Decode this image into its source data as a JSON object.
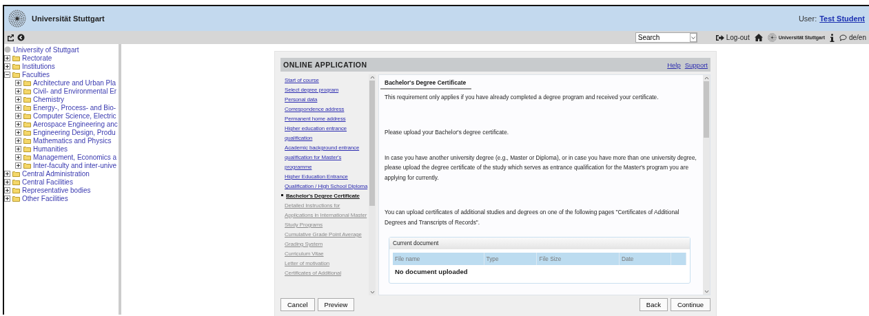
{
  "header": {
    "title": "Universität Stuttgart",
    "user_label": "User:",
    "user_name": "Test Student"
  },
  "toolbar": {
    "search": {
      "value": "Search"
    },
    "logout": "Log-out",
    "logo_text": "Universität Stuttgart",
    "language": "de/en"
  },
  "tree": {
    "root": "University of Stuttgart",
    "items": [
      {
        "label": "Rectorate",
        "expanded": false
      },
      {
        "label": "Institutions",
        "expanded": false
      },
      {
        "label": "Faculties",
        "expanded": true,
        "children": [
          {
            "label": "Architecture and Urban Pla",
            "expanded": false
          },
          {
            "label": "Civil- and Environmental Er",
            "expanded": false
          },
          {
            "label": "Chemistry",
            "expanded": false
          },
          {
            "label": "Energy-, Process- and Bio-",
            "expanded": false
          },
          {
            "label": "Computer Science, Electric",
            "expanded": false
          },
          {
            "label": "Aerospace Engineering anc",
            "expanded": false
          },
          {
            "label": "Engineering Design, Produ",
            "expanded": false
          },
          {
            "label": "Mathematics and Physics",
            "expanded": false
          },
          {
            "label": "Humanities",
            "expanded": false
          },
          {
            "label": "Management, Economics a",
            "expanded": false
          },
          {
            "label": "Inter-faculty and inter-unive",
            "expanded": false
          }
        ]
      },
      {
        "label": "Central Administration",
        "expanded": false
      },
      {
        "label": "Central Facilities",
        "expanded": false
      },
      {
        "label": "Representative bodies",
        "expanded": false
      },
      {
        "label": "Other Facilities",
        "expanded": false
      }
    ]
  },
  "dialog": {
    "title": "ONLINE APPLICATION",
    "links": [
      "Help",
      "Support"
    ],
    "steps": [
      {
        "label": "Start of course",
        "selected": false,
        "disabled": false
      },
      {
        "label": "Select degree program",
        "selected": false,
        "disabled": false
      },
      {
        "label": "Personal data",
        "selected": false,
        "disabled": false
      },
      {
        "label": "Correspondence address",
        "selected": false,
        "disabled": false
      },
      {
        "label": "Permanent home address",
        "selected": false,
        "disabled": false
      },
      {
        "label": "Higher education entrance qualification",
        "selected": false,
        "disabled": false
      },
      {
        "label": "Academic background entrance qualification for Master's programme",
        "selected": false,
        "disabled": false
      },
      {
        "label": "Higher Education Entrance Qualification / High School Diploma",
        "selected": false,
        "disabled": false
      },
      {
        "label": "Bachelor's Degree Certificate",
        "selected": true,
        "disabled": false
      },
      {
        "label": "Detailed Instructions for Applications in International Master Study Programs",
        "selected": false,
        "disabled": true
      },
      {
        "label": "Cumulative Grade Point Average",
        "selected": false,
        "disabled": true
      },
      {
        "label": "Grading System",
        "selected": false,
        "disabled": true
      },
      {
        "label": "Curriculum Vitae",
        "selected": false,
        "disabled": true
      },
      {
        "label": "Letter of motivation",
        "selected": false,
        "disabled": true
      },
      {
        "label": "Certificates of Additional",
        "selected": false,
        "disabled": true
      }
    ],
    "heading": "Bachelor's Degree Certificate",
    "paragraphs": [
      "This requirement only applies if you have already completed a degree program and received your certificate.",
      "Please upload your Bachelor's degree certificate.",
      "In case you have another university degree (e.g., Master or Diploma), or in case you have more than one university degree, please upload the degree certificate of the study which serves as entrance qualification for the Master's program you are applying for currently.",
      "You can upload certificates of additional studies and degrees on one of the following pages \"Certificates of Additional Degrees and Transcripts of Records\"."
    ],
    "current_document": {
      "legend": "Current document",
      "columns": [
        "File name",
        "Type",
        "File Size",
        "Date"
      ],
      "empty": "No document uploaded"
    },
    "left_buttons": [
      "Cancel",
      "Preview"
    ],
    "right_buttons": [
      "Back",
      "Continue"
    ]
  }
}
